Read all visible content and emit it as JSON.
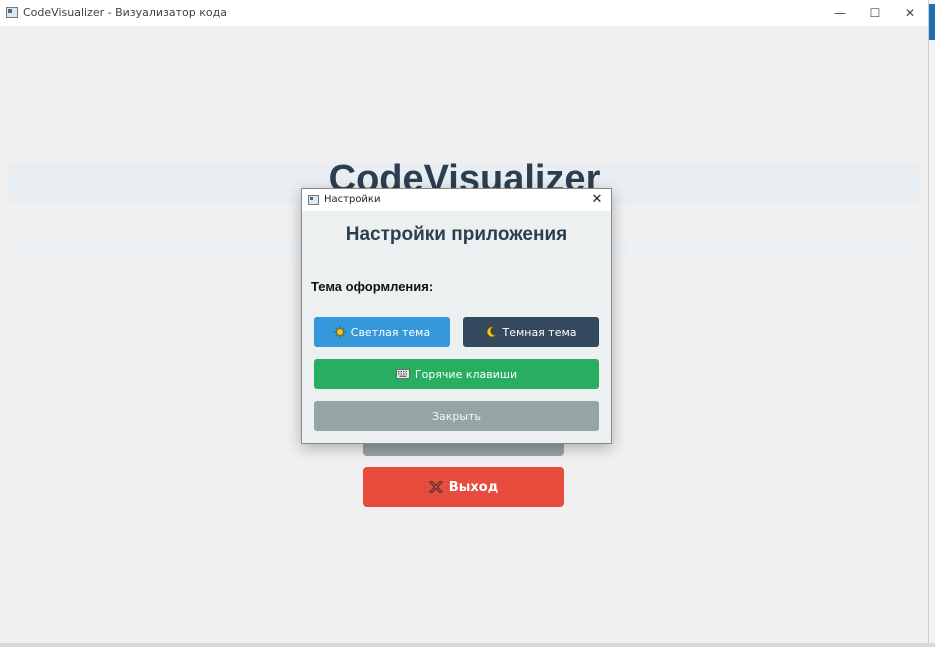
{
  "window": {
    "title": "CodeVisualizer - Визуализатор кода",
    "minimize_glyph": "—",
    "maximize_glyph": "☐",
    "close_glyph": "✕"
  },
  "main": {
    "app_title": "CodeVisualizer",
    "exit_label": "Выход",
    "exit_icon": "cross-mark-icon"
  },
  "dialog": {
    "title": "Настройки",
    "close_glyph": "✕",
    "heading": "Настройки приложения",
    "theme_label": "Тема оформления:",
    "light_theme_label": "Светлая тема",
    "light_theme_icon": "sun-icon",
    "dark_theme_label": "Темная тема",
    "dark_theme_icon": "moon-icon",
    "hotkeys_label": "Горячие клавиши",
    "hotkeys_icon": "keyboard-icon",
    "close_label": "Закрыть"
  },
  "colors": {
    "primary_blue": "#3498db",
    "dark": "#34495e",
    "green": "#27ae60",
    "gray": "#95a5a6",
    "red": "#e74c3c",
    "heading": "#2c3e50"
  }
}
